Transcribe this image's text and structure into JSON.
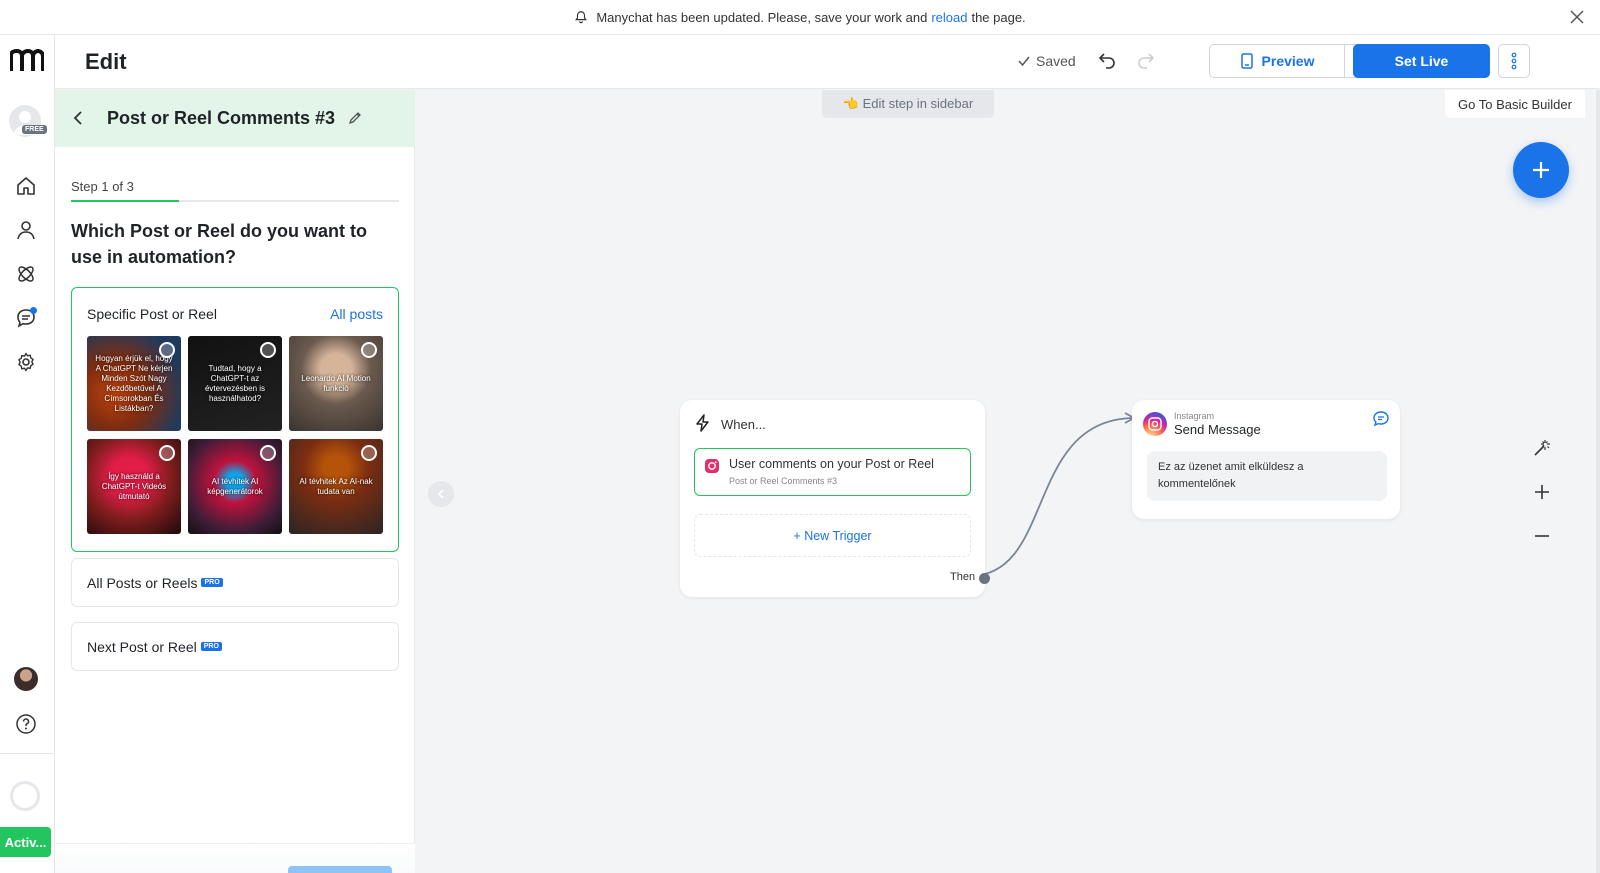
{
  "banner": {
    "text_before": "Manychat has been updated. Please, save your work and",
    "link": "reload",
    "text_after": "the page."
  },
  "rail": {
    "free_badge": "FREE",
    "active_label": "Activ..."
  },
  "header": {
    "title": "Edit",
    "saved": "Saved",
    "preview": "Preview",
    "set_live": "Set Live"
  },
  "panel": {
    "title": "Post or Reel Comments #3",
    "step": "Step 1 of 3",
    "progress_fraction": 0.33,
    "question": "Which Post or Reel do you want to use in automation?",
    "specific_label": "Specific Post or Reel",
    "all_posts": "All posts",
    "thumbnails": [
      {
        "text": "Hogyan érjük el, hogy A ChatGPT Ne kérjen Minden Szót Nagy Kezdőbetűvel A Címsorokban És Listákban?"
      },
      {
        "text": "Tudtad, hogy a ChatGPT-t az évtervezésben is használhatod?"
      },
      {
        "text": "Leonardo AI Motion funkció"
      },
      {
        "text": "Így használd a ChatGPT-t Videós útmutató"
      },
      {
        "text": "AI tévhitek AI képgenerátorok"
      },
      {
        "text": "AI tévhitek Az AI-nak tudata van"
      }
    ],
    "option_all": "All Posts or Reels",
    "option_next": "Next Post or Reel",
    "pro_badge": "PRO"
  },
  "canvas": {
    "hint": "👈 Edit step in sidebar",
    "basic_builder": "Go To Basic Builder",
    "when_node": {
      "label": "When...",
      "trigger_title": "User comments on your Post or Reel",
      "trigger_sub": "Post or Reel Comments #3",
      "new_trigger": "+ New Trigger",
      "then": "Then"
    },
    "message_node": {
      "platform": "Instagram",
      "title": "Send Message",
      "text": "Ez az üzenet amit elküldesz a kommentelőnek"
    }
  },
  "colors": {
    "accent": "#1a73e8",
    "success": "#22c55e",
    "panel_header": "#e3f5e8"
  }
}
